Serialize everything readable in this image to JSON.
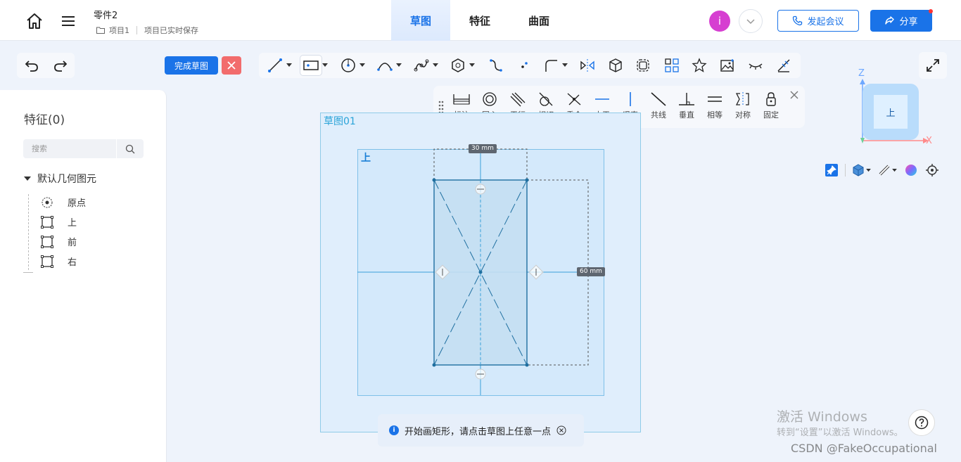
{
  "header": {
    "title": "零件2",
    "project": "项目1",
    "save_status": "项目已实时保存",
    "tabs": [
      {
        "label": "草图",
        "active": true
      },
      {
        "label": "特征",
        "active": false
      },
      {
        "label": "曲面",
        "active": false
      }
    ],
    "avatar_letter": "i",
    "meeting_label": "发起会议",
    "share_label": "分享"
  },
  "toolbar": {
    "finish_label": "完成草图",
    "tools": [
      "line-icon",
      "rectangle-icon",
      "circle-icon",
      "arc-icon",
      "spline-icon",
      "polygon-icon",
      "curve-icon",
      "point-icon",
      "fillet-icon",
      "mirror-icon",
      "box-icon",
      "offset-icon",
      "pattern-icon",
      "star-icon",
      "image-icon",
      "hide-icon",
      "measure-icon"
    ]
  },
  "constraints": {
    "items": [
      {
        "label": "标注",
        "icon": "dimension-icon"
      },
      {
        "label": "同心",
        "icon": "concentric-icon"
      },
      {
        "label": "平行",
        "icon": "parallel-icon"
      },
      {
        "label": "相切",
        "icon": "tangent-icon"
      },
      {
        "label": "重合",
        "icon": "coincident-icon"
      },
      {
        "label": "水平",
        "icon": "horizontal-icon"
      },
      {
        "label": "竖直",
        "icon": "vertical-icon"
      },
      {
        "label": "共线",
        "icon": "collinear-icon"
      },
      {
        "label": "垂直",
        "icon": "perpendicular-icon"
      },
      {
        "label": "相等",
        "icon": "equal-icon"
      },
      {
        "label": "对称",
        "icon": "symmetric-icon"
      },
      {
        "label": "固定",
        "icon": "fix-icon"
      }
    ]
  },
  "feature_panel": {
    "title": "特征(0)",
    "search_placeholder": "搜索",
    "root_label": "默认几何图元",
    "items": [
      {
        "label": "原点",
        "icon": "origin-icon"
      },
      {
        "label": "上",
        "icon": "plane-icon"
      },
      {
        "label": "前",
        "icon": "plane-icon"
      },
      {
        "label": "右",
        "icon": "plane-icon"
      }
    ]
  },
  "canvas": {
    "sketch_name": "草图01",
    "plane_name": "上",
    "dim_width": "30 mm",
    "dim_height": "60 mm",
    "hint": "开始画矩形，请点击草图上任意一点"
  },
  "viewcube": {
    "face": "上",
    "axis_z": "Z",
    "axis_x": "X"
  },
  "watermark": {
    "line1": "激活 Windows",
    "line2": "转到“设置”以激活 Windows。",
    "credit": "CSDN @FakeOccupational"
  },
  "colors": {
    "accent": "#1a73e8",
    "sketch": "#1f6fa0",
    "danger": "#f26c6c"
  }
}
